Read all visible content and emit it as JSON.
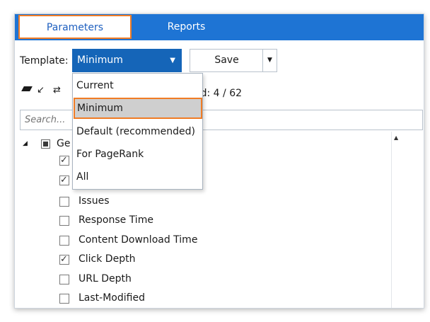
{
  "tabs": {
    "parameters": "Parameters",
    "reports": "Reports"
  },
  "template": {
    "label": "Template:",
    "selected": "Minimum",
    "options": [
      "Current",
      "Minimum",
      "Default (recommended)",
      "For PageRank",
      "All"
    ]
  },
  "save_label": "Save",
  "selected_count_text": "ed: 4 / 62",
  "search": {
    "placeholder": "Search..."
  },
  "tree": {
    "group_label": "Ge",
    "items": [
      {
        "label": "",
        "checked": true
      },
      {
        "label": "",
        "checked": true
      },
      {
        "label": "Issues",
        "checked": false
      },
      {
        "label": "Response Time",
        "checked": false
      },
      {
        "label": "Content Download Time",
        "checked": false
      },
      {
        "label": "Click Depth",
        "checked": true
      },
      {
        "label": "URL Depth",
        "checked": false
      },
      {
        "label": "Last-Modified",
        "checked": false
      }
    ]
  },
  "colors": {
    "accent": "#1e74d4",
    "select_bg": "#1565b8",
    "highlight": "#f07c25"
  }
}
